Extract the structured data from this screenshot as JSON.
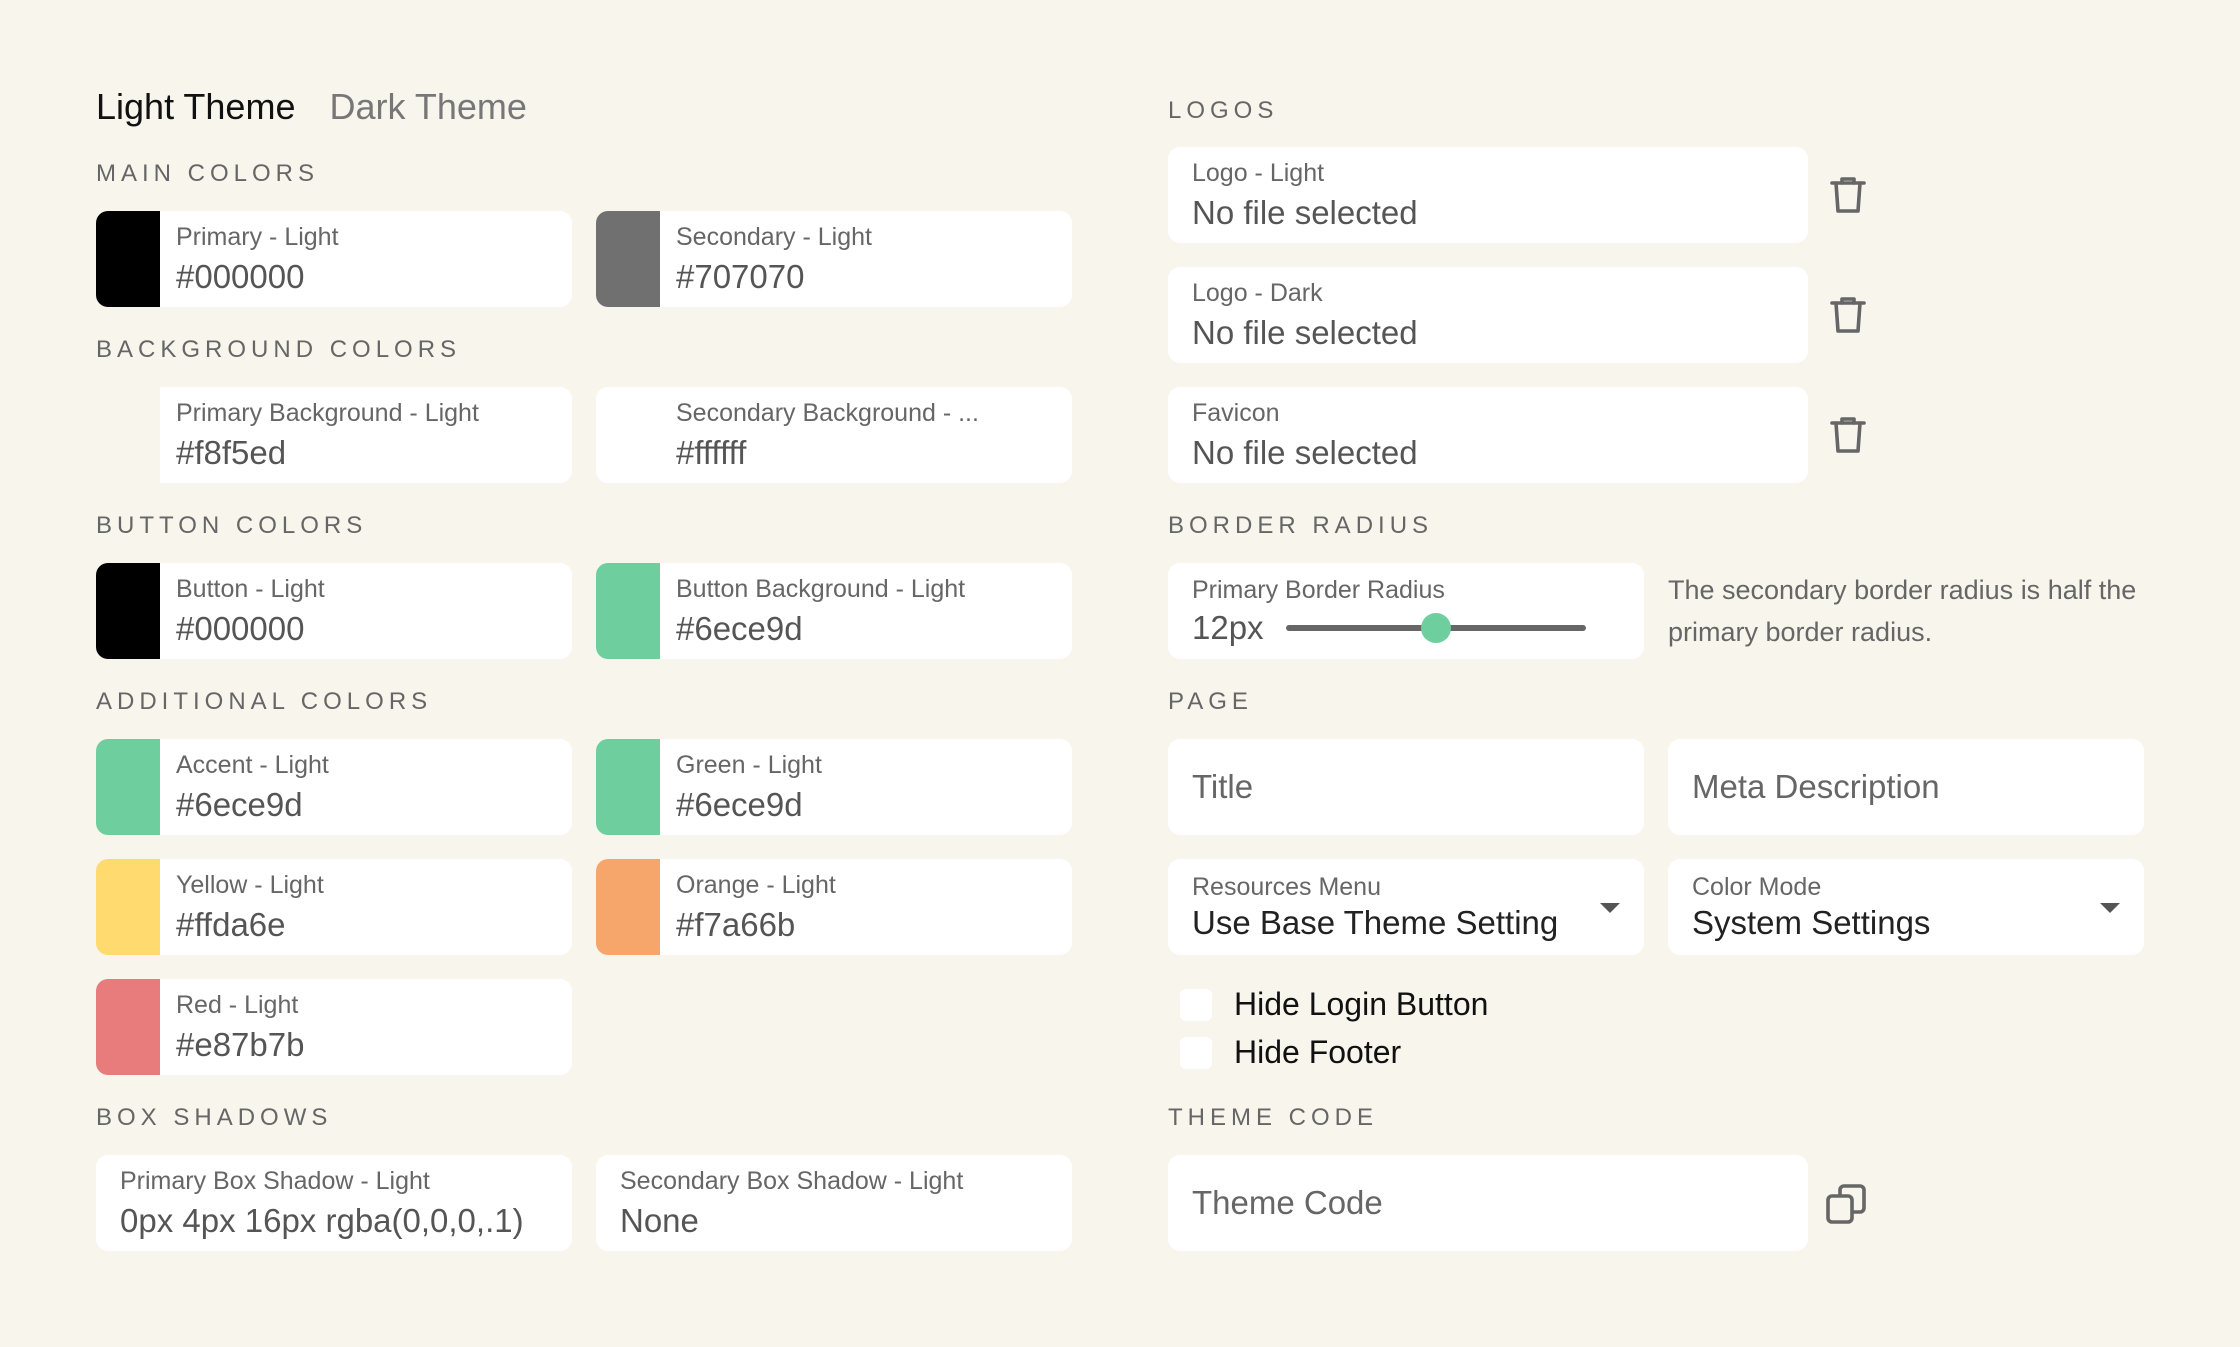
{
  "tabs": [
    "Light Theme",
    "Dark Theme"
  ],
  "sections": {
    "main_colors": "MAIN COLORS",
    "background_colors": "BACKGROUND COLORS",
    "button_colors": "BUTTON COLORS",
    "additional_colors": "ADDITIONAL COLORS",
    "box_shadows": "BOX SHADOWS",
    "logos": "LOGOS",
    "border_radius": "BORDER RADIUS",
    "page": "PAGE",
    "theme_code": "THEME CODE"
  },
  "colors": {
    "primary": {
      "label": "Primary - Light",
      "value": "#000000",
      "swatch": "#000000"
    },
    "secondary": {
      "label": "Secondary - Light",
      "value": "#707070",
      "swatch": "#707070"
    },
    "primary_bg": {
      "label": "Primary Background - Light",
      "value": "#f8f5ed",
      "swatch": "#f8f5ed"
    },
    "secondary_bg": {
      "label": "Secondary Background - ...",
      "value": "#ffffff",
      "swatch": "#ffffff"
    },
    "button": {
      "label": "Button - Light",
      "value": "#000000",
      "swatch": "#000000"
    },
    "button_bg": {
      "label": "Button Background - Light",
      "value": "#6ece9d",
      "swatch": "#6ece9d"
    },
    "accent": {
      "label": "Accent - Light",
      "value": "#6ece9d",
      "swatch": "#6ece9d"
    },
    "green": {
      "label": "Green - Light",
      "value": "#6ece9d",
      "swatch": "#6ece9d"
    },
    "yellow": {
      "label": "Yellow - Light",
      "value": "#ffda6e",
      "swatch": "#ffda6e"
    },
    "orange": {
      "label": "Orange - Light",
      "value": "#f7a66b",
      "swatch": "#f7a66b"
    },
    "red": {
      "label": "Red - Light",
      "value": "#e87b7b",
      "swatch": "#e87b7b"
    }
  },
  "shadows": {
    "primary": {
      "label": "Primary Box Shadow - Light",
      "value": "0px 4px 16px rgba(0,0,0,.1)"
    },
    "secondary": {
      "label": "Secondary Box Shadow - Light",
      "value": "None"
    }
  },
  "logos": {
    "light": {
      "label": "Logo - Light",
      "value": "No file selected"
    },
    "dark": {
      "label": "Logo - Dark",
      "value": "No file selected"
    },
    "favicon": {
      "label": "Favicon",
      "value": "No file selected"
    }
  },
  "border_radius": {
    "label": "Primary Border Radius",
    "value": "12px",
    "slider_fraction": 0.5,
    "helper": "The secondary border radius is half the primary border radius."
  },
  "page": {
    "title_placeholder": "Title",
    "meta_placeholder": "Meta Description",
    "resources_menu": {
      "label": "Resources Menu",
      "value": "Use Base Theme Setting"
    },
    "color_mode": {
      "label": "Color Mode",
      "value": "System Settings"
    },
    "hide_login": "Hide Login Button",
    "hide_footer": "Hide Footer"
  },
  "theme_code": {
    "placeholder": "Theme Code"
  }
}
